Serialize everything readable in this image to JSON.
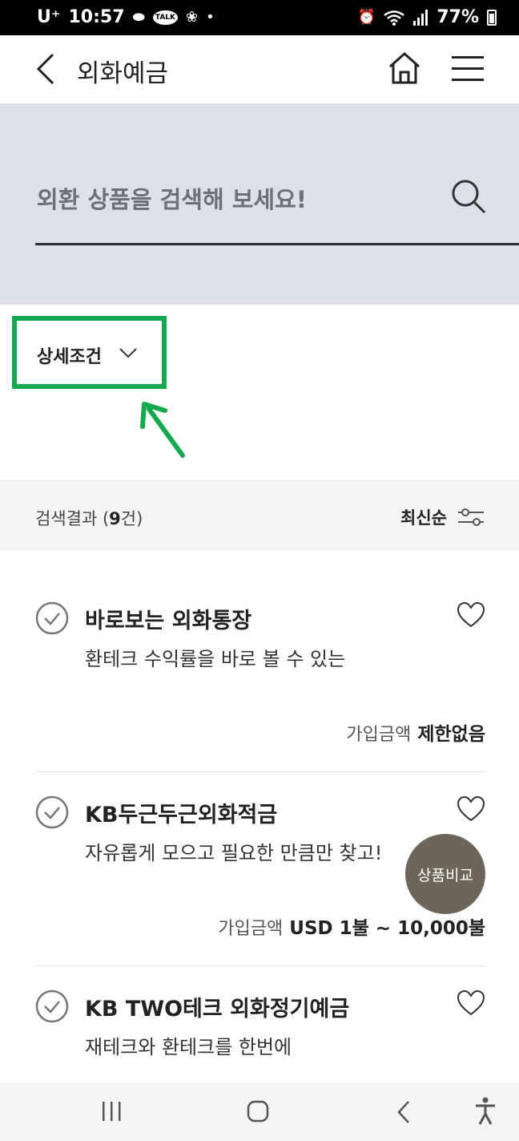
{
  "status_bar": {
    "carrier": "U⁺",
    "time": "10:57",
    "dot": "•",
    "battery": "77%"
  },
  "header": {
    "title": "외화예금"
  },
  "search": {
    "placeholder": "외환 상품을 검색해 보세요!"
  },
  "filter": {
    "label": "상세조건"
  },
  "results": {
    "label_prefix": "검색결과 (",
    "count": "9",
    "label_suffix": "건)",
    "sort_label": "최신순"
  },
  "products": [
    {
      "name": "바로보는 외화통장",
      "desc": "환테크 수익률을 바로 볼 수 있는",
      "amount_label": "가입금액",
      "amount_value": "제한없음"
    },
    {
      "name": "KB두근두근외화적금",
      "desc": "자유롭게 모으고 필요한 만큼만 찾고!",
      "amount_label": "가입금액",
      "amount_value": "USD 1불 ~ 10,000불"
    },
    {
      "name": "KB TWO테크 외화정기예금",
      "desc": "재테크와 환테크를 한번에"
    }
  ],
  "compare_button": "상품비교",
  "colors": {
    "highlight": "#12a94f",
    "search_bg": "#dde0e9",
    "compare_bg": "#6d6559"
  }
}
